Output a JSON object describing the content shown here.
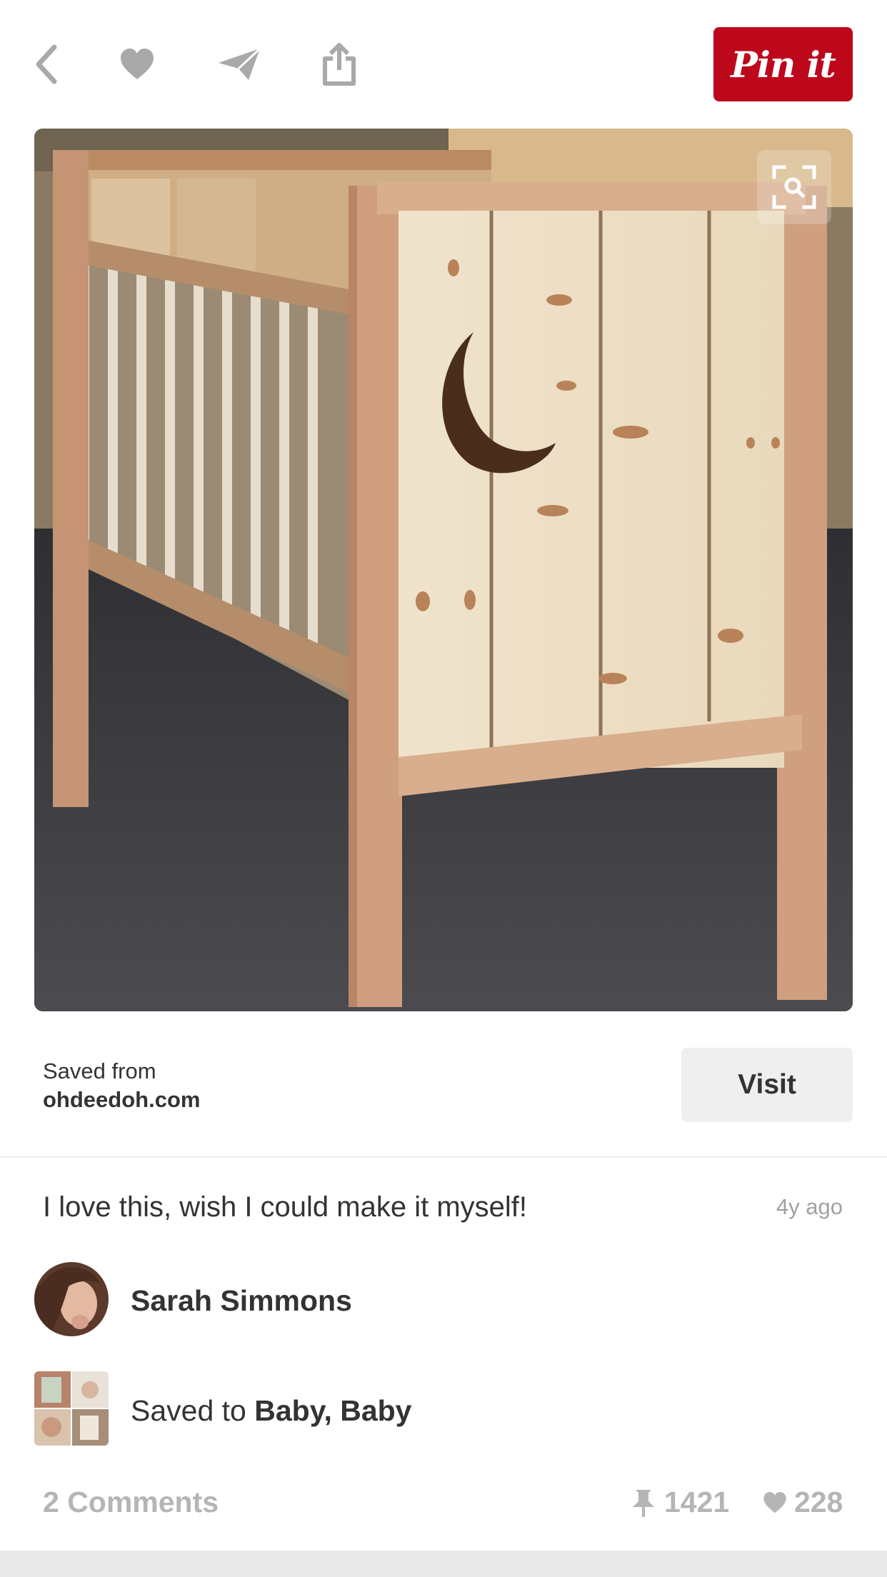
{
  "toolbar": {
    "icons": [
      "back-arrow-icon",
      "heart-icon",
      "send-icon",
      "share-icon"
    ],
    "pin_label": "Pin it",
    "pin_color": "#bd081c"
  },
  "image": {
    "description_icon": "visual-search-icon"
  },
  "source": {
    "label": "Saved from",
    "domain": "ohdeedoh.com",
    "visit_label": "Visit"
  },
  "comment": {
    "text": "I love this, wish I could make it myself!",
    "age": "4y ago"
  },
  "user": {
    "name": "Sarah Simmons"
  },
  "board": {
    "prefix": "Saved to ",
    "name": "Baby, Baby"
  },
  "footer": {
    "comments_label": "2 Comments",
    "repins": "1421",
    "likes": "228"
  }
}
